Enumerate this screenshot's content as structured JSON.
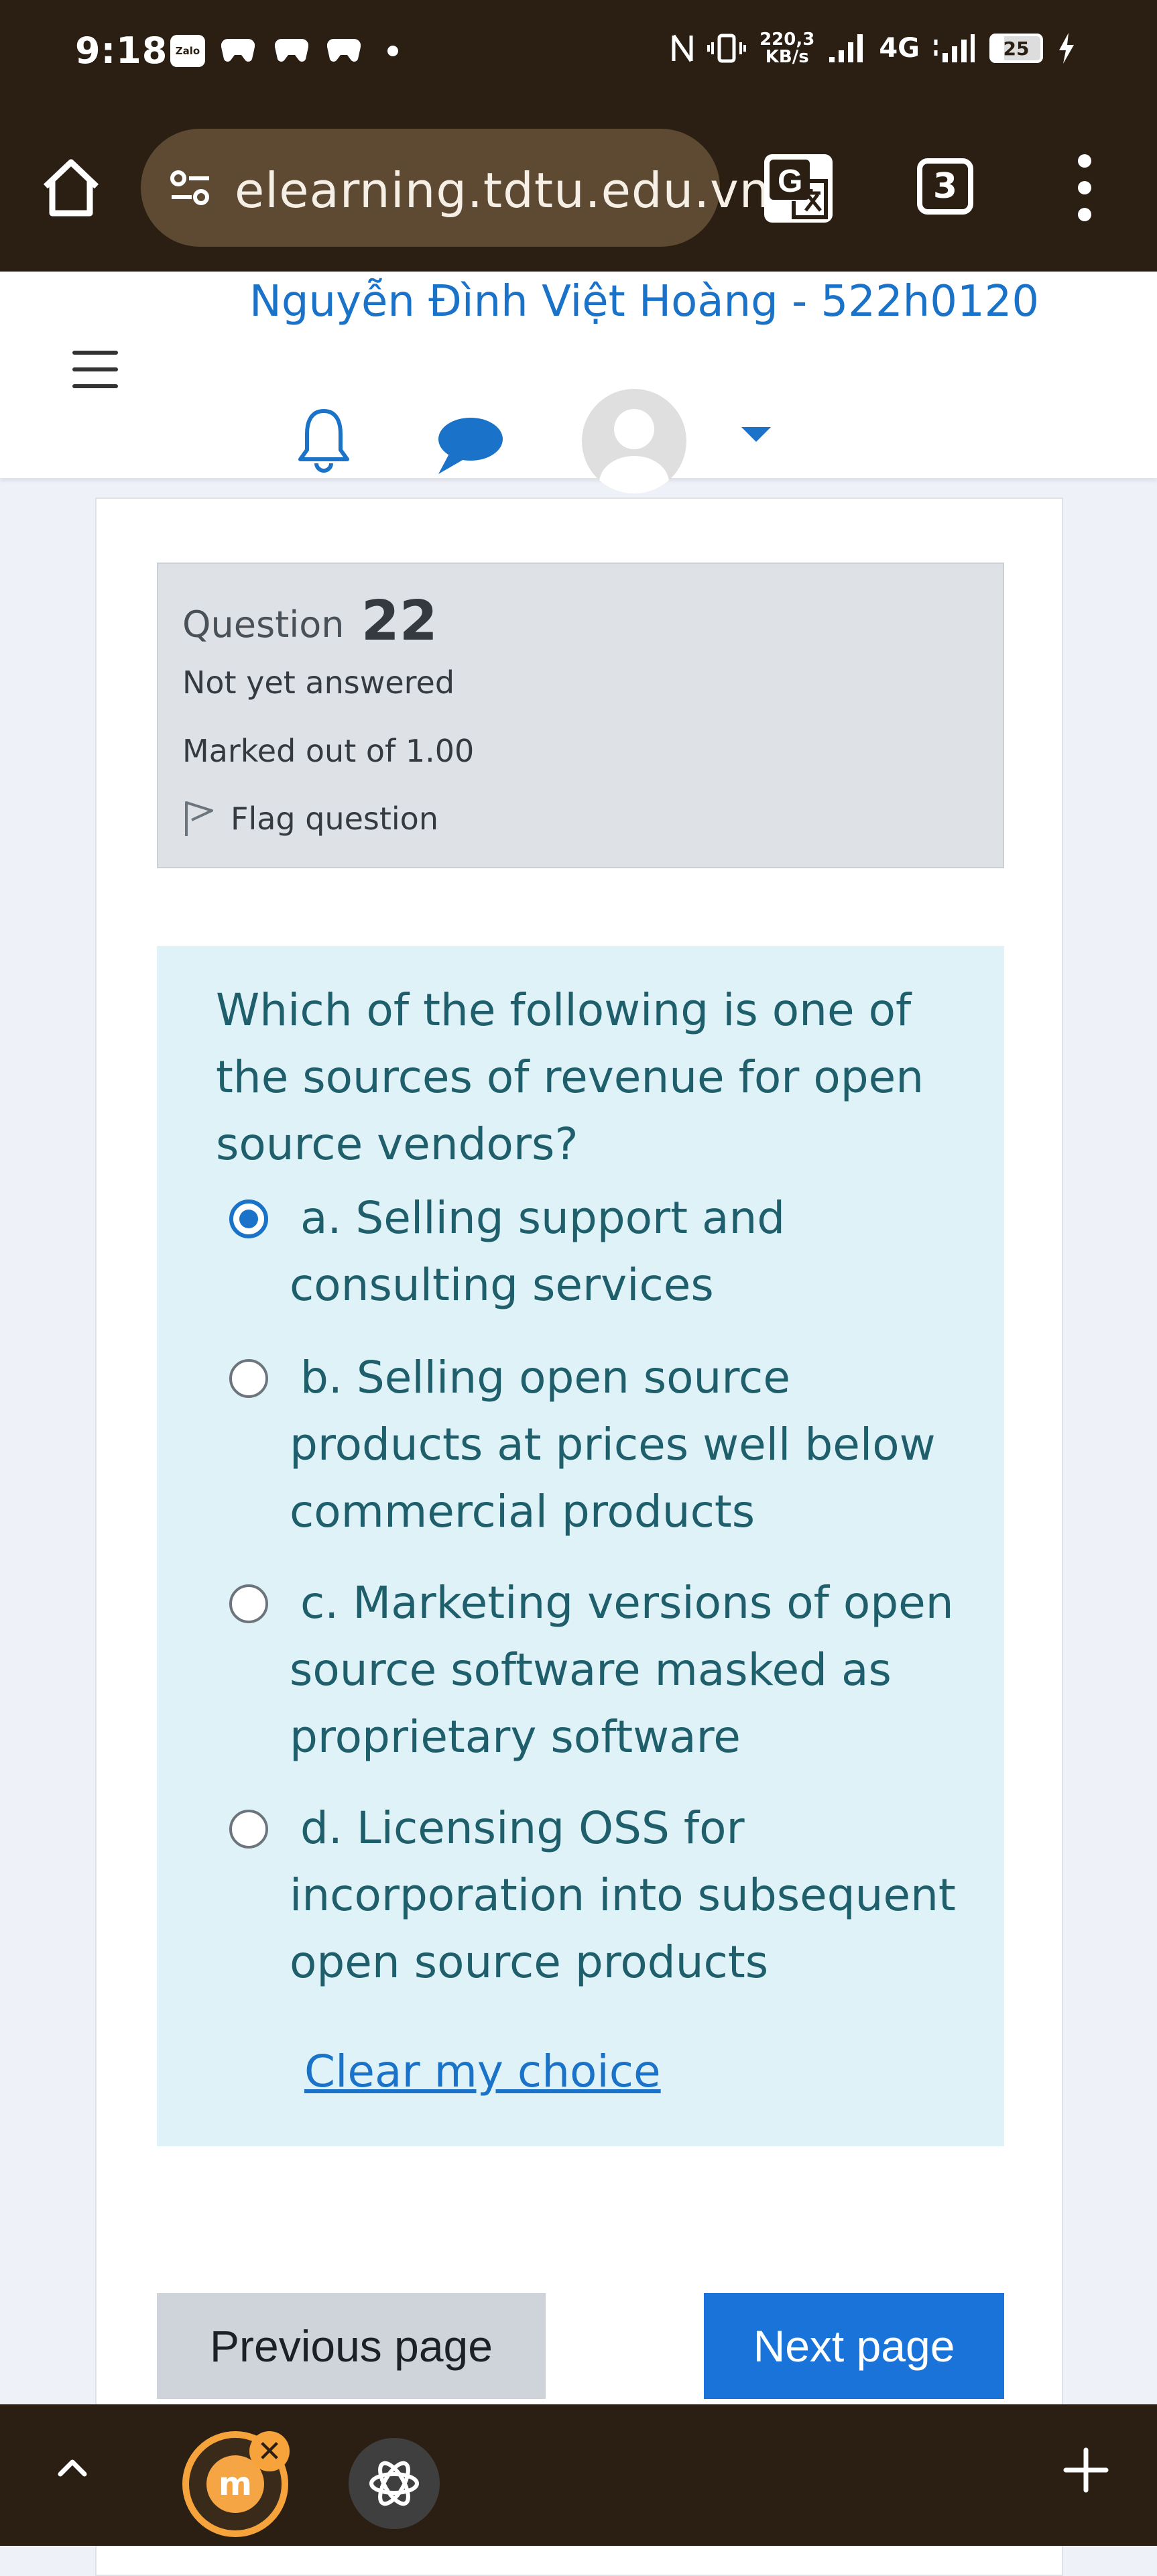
{
  "status_bar": {
    "time": "9:18",
    "zalo_label": "Zalo",
    "speed_value": "220,3",
    "speed_unit": "KB/s",
    "network": "4G",
    "battery": "25"
  },
  "browser": {
    "url": "elearning.tdtu.edu.vn/",
    "tab_count": "3"
  },
  "header": {
    "user_name": "Nguyễn Đình Việt Hoàng - 522h0120"
  },
  "question_info": {
    "label": "Question",
    "number": "22",
    "state": "Not yet answered",
    "mark": "Marked out of 1.00",
    "flag_label": "Flag question"
  },
  "question": {
    "text": "Which of the following is one of the sources of revenue for open source vendors?",
    "answers": [
      {
        "label": "a. Selling support and consulting services",
        "selected": true
      },
      {
        "label": "b. Selling open source products at prices well below commercial products",
        "selected": false
      },
      {
        "label": "c. Marketing versions of open source software masked as proprietary software",
        "selected": false
      },
      {
        "label": "d. Licensing OSS for incorporation into subsequent open source products",
        "selected": false
      }
    ],
    "clear_choice": "Clear my choice"
  },
  "navigation": {
    "previous": "Previous page",
    "next": "Next page"
  },
  "bottom_bar": {
    "moodle_letter": "m",
    "close_glyph": "✕"
  },
  "colors": {
    "accent": "#1a73c8",
    "question_bg": "#def2f8",
    "info_bg": "#dee2e6",
    "chrome_bg": "#2b1f14"
  }
}
